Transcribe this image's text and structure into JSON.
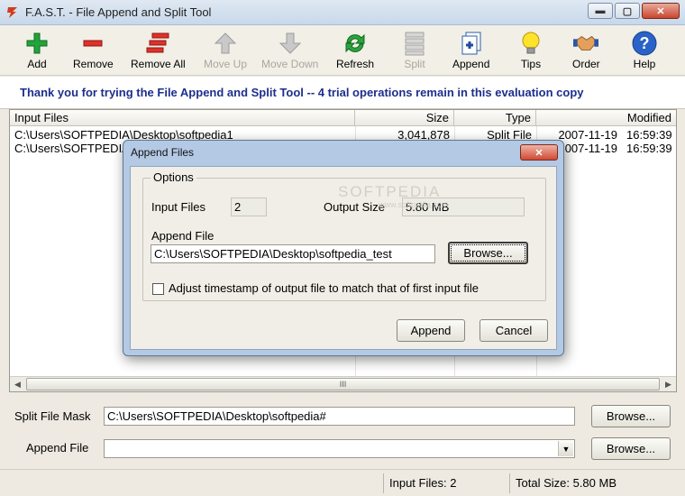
{
  "window": {
    "title": "F.A.S.T. - File Append and Split Tool",
    "min_label": "▬",
    "max_label": "▢",
    "close_label": "✕"
  },
  "toolbar": {
    "items": [
      {
        "label": "Add",
        "icon": "plus-icon",
        "enabled": true
      },
      {
        "label": "Remove",
        "icon": "minus-icon",
        "enabled": true
      },
      {
        "label": "Remove All",
        "icon": "remove-all-icon",
        "enabled": true
      },
      {
        "label": "Move Up",
        "icon": "arrow-up-icon",
        "enabled": false
      },
      {
        "label": "Move Down",
        "icon": "arrow-down-icon",
        "enabled": false
      },
      {
        "label": "Refresh",
        "icon": "refresh-icon",
        "enabled": true
      },
      {
        "label": "Split",
        "icon": "split-icon",
        "enabled": false
      },
      {
        "label": "Append",
        "icon": "append-icon",
        "enabled": true
      },
      {
        "label": "Tips",
        "icon": "lightbulb-icon",
        "enabled": true
      },
      {
        "label": "Order",
        "icon": "handshake-icon",
        "enabled": true
      },
      {
        "label": "Help",
        "icon": "help-icon",
        "enabled": true
      }
    ]
  },
  "banner": {
    "text": "Thank you for trying the File Append and Split Tool -- 4 trial operations remain in this evaluation copy"
  },
  "file_list": {
    "columns": [
      "Input Files",
      "Size",
      "Type",
      "Modified"
    ],
    "rows": [
      {
        "name": "C:\\Users\\SOFTPEDIA\\Desktop\\softpedia1",
        "size": "3,041,878",
        "type": "Split File",
        "date": "2007-11-19",
        "time": "16:59:39"
      },
      {
        "name": "C:\\Users\\SOFTPEDIA\\Desktop\\softpedia2",
        "size": "",
        "type": "",
        "date": "2007-11-19",
        "time": "16:59:39"
      }
    ],
    "row_name_visible": [
      "C:\\Users\\SOFTPEDIA\\Desktop\\softpedia1",
      "C:\\Users\\SOFTPEDIA\\"
    ],
    "row_date_visible": [
      "2007-11-19",
      "007-11-19"
    ],
    "scroll_grip": "III"
  },
  "form": {
    "split_mask_label": "Split File Mask",
    "split_mask_value": "C:\\Users\\SOFTPEDIA\\Desktop\\softpedia#",
    "append_file_label": "Append File",
    "append_file_value": "",
    "browse_label": "Browse..."
  },
  "status": {
    "input_files": "Input Files: 2",
    "total_size": "Total Size: 5.80 MB"
  },
  "dialog": {
    "title": "Append Files",
    "group_title": "Options",
    "input_files_label": "Input Files",
    "input_files_value": "2",
    "output_size_label": "Output Size",
    "output_size_value": "5.80 MB",
    "append_file_label": "Append File",
    "append_file_value": "C:\\Users\\SOFTPEDIA\\Desktop\\softpedia_test",
    "browse_label": "Browse...",
    "checkbox_label": "Adjust timestamp of output file to match that of first input file",
    "checkbox_checked": false,
    "append_button": "Append",
    "cancel_button": "Cancel"
  },
  "watermark": {
    "text": "SOFTPEDIA",
    "sub": "www.softpedia.com"
  }
}
